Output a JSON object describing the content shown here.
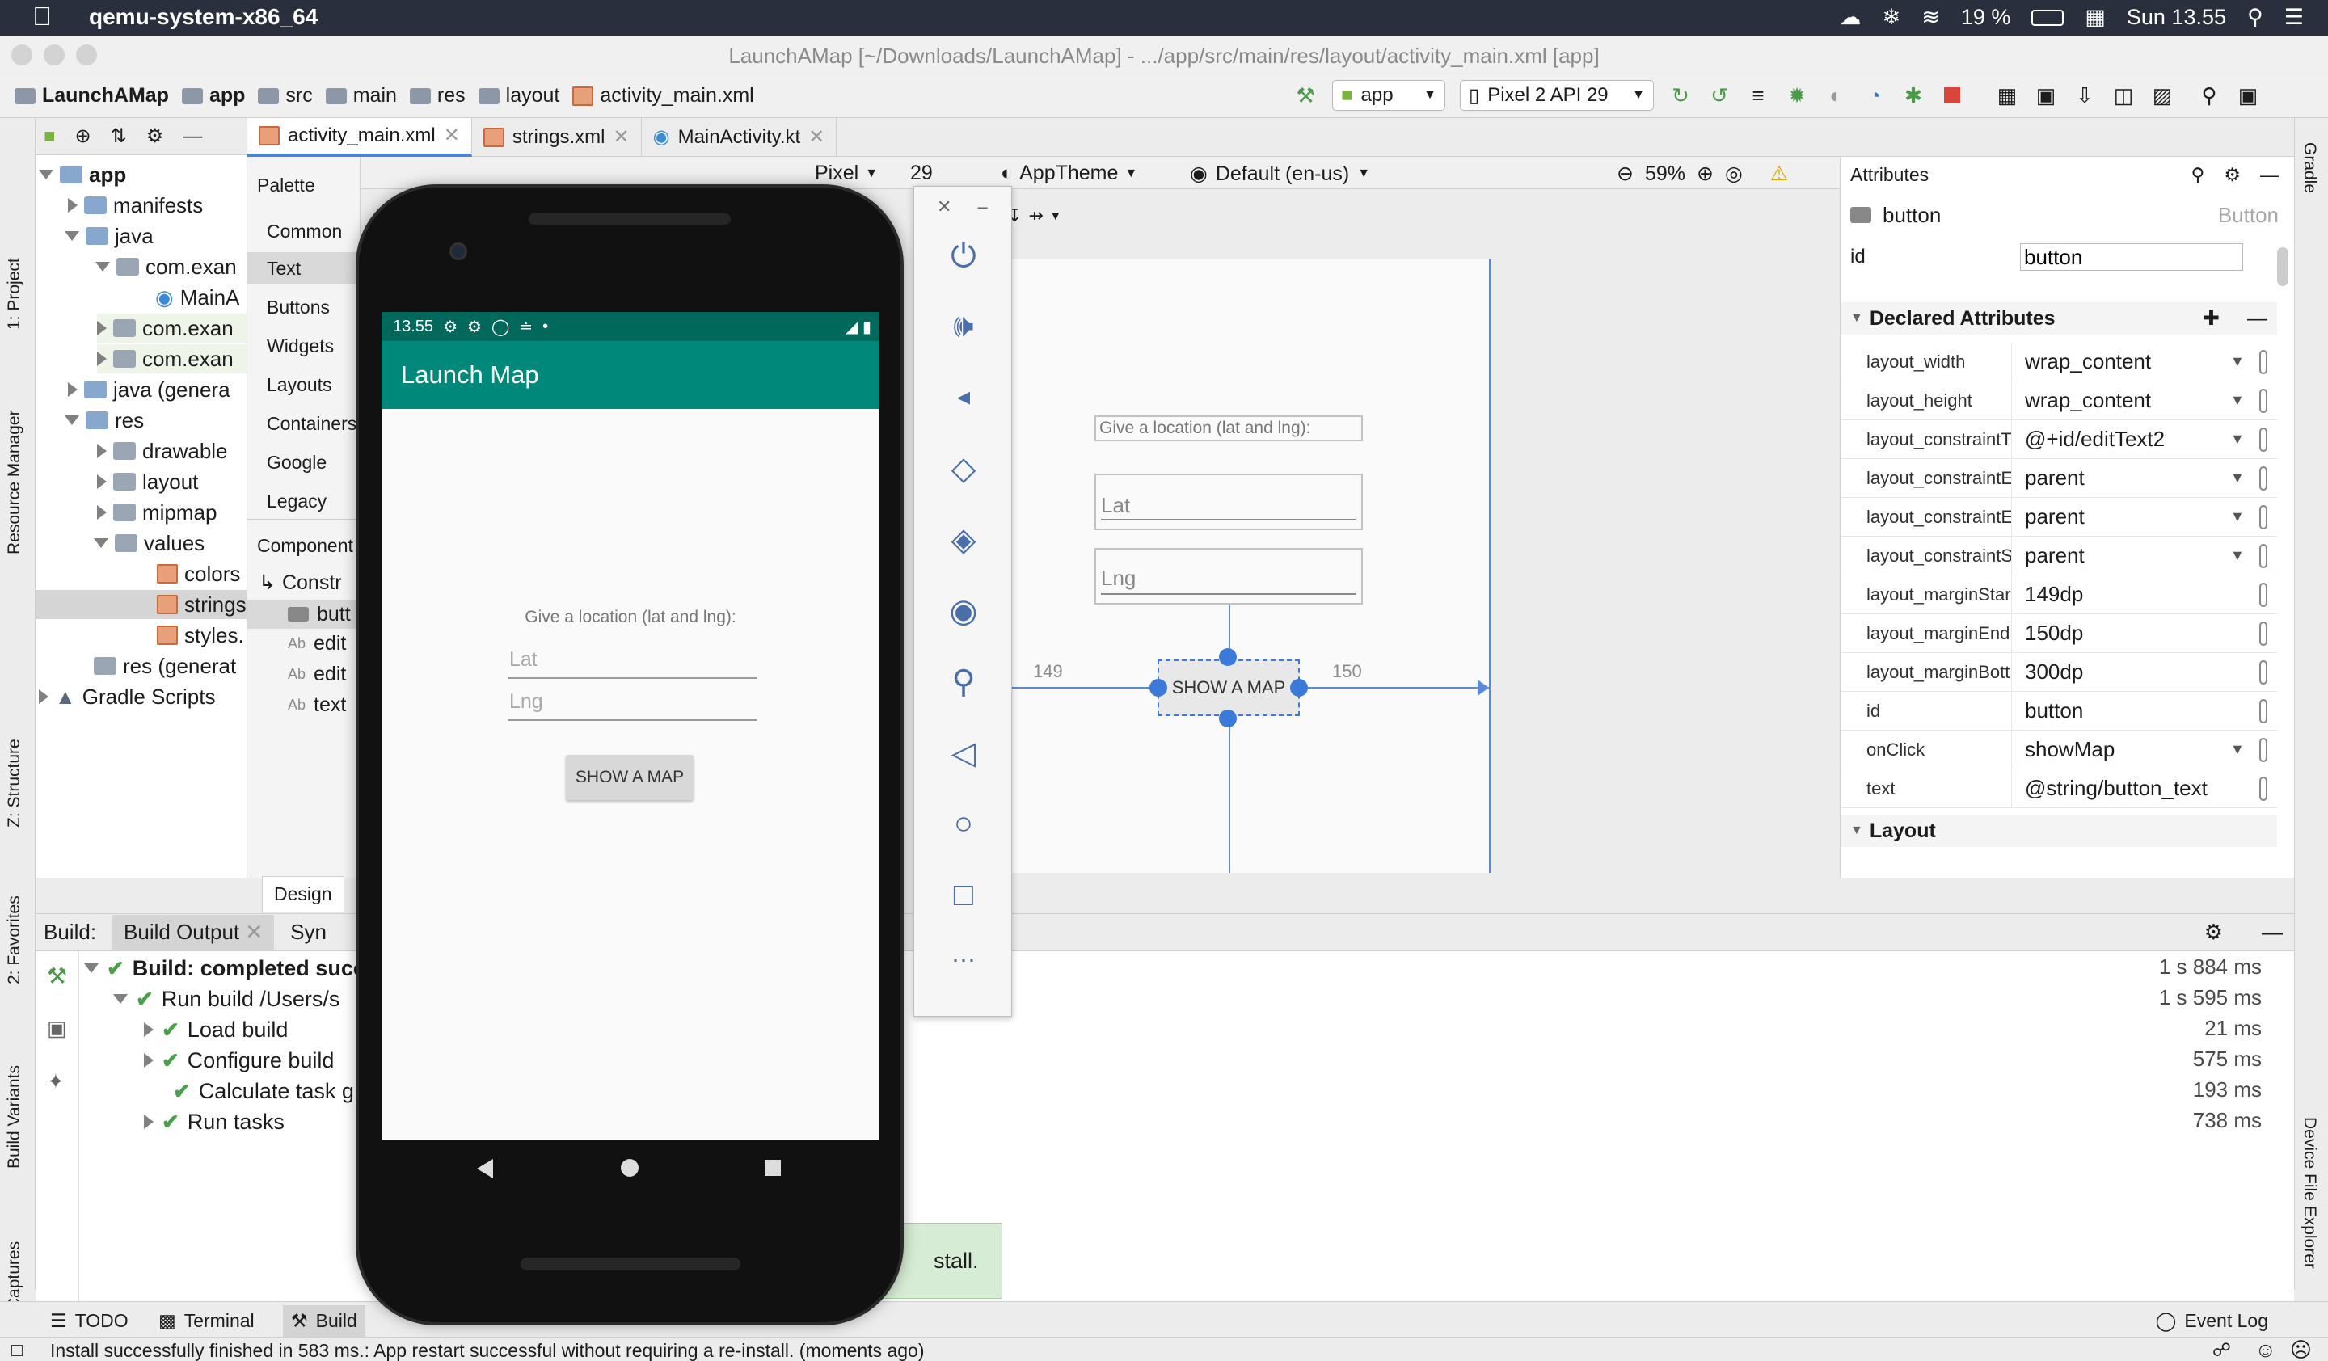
{
  "mac": {
    "app_name": "qemu-system-x86_64",
    "battery": "19 %",
    "clock": "Sun 13.55"
  },
  "window": {
    "title": "LaunchAMap [~/Downloads/LaunchAMap] - .../app/src/main/res/layout/activity_main.xml [app]"
  },
  "breadcrumbs": [
    "LaunchAMap",
    "app",
    "src",
    "main",
    "res",
    "layout",
    "activity_main.xml"
  ],
  "toolbar": {
    "run_config": "app",
    "device": "Pixel 2 API 29"
  },
  "editor_tabs": [
    "activity_main.xml",
    "strings.xml",
    "MainActivity.kt"
  ],
  "left_strip": {
    "project": "1: Project",
    "resource_manager": "Resource Manager",
    "structure": "Z: Structure",
    "favorites": "2: Favorites",
    "build_variants": "Build Variants",
    "layout_captures": "Layout Captures"
  },
  "right_strip": {
    "gradle": "Gradle",
    "device_file_explorer": "Device File Explorer"
  },
  "project_tree": [
    {
      "label": "app",
      "bold": true
    },
    {
      "label": "manifests"
    },
    {
      "label": "java"
    },
    {
      "label": "com.exan"
    },
    {
      "label": "MainA"
    },
    {
      "label": "com.exan"
    },
    {
      "label": "com.exan"
    },
    {
      "label": "java (genera"
    },
    {
      "label": "res"
    },
    {
      "label": "drawable"
    },
    {
      "label": "layout"
    },
    {
      "label": "mipmap"
    },
    {
      "label": "values"
    },
    {
      "label": "colors"
    },
    {
      "label": "strings"
    },
    {
      "label": "styles."
    },
    {
      "label": "res (generat"
    },
    {
      "label": "Gradle Scripts"
    }
  ],
  "palette": {
    "title": "Palette",
    "categories": [
      "Common",
      "Text",
      "Buttons",
      "Widgets",
      "Layouts",
      "Containers",
      "Google",
      "Legacy"
    ],
    "component_tree_title": "Component",
    "components": [
      "Constr",
      "butt",
      "edit",
      "edit",
      "text"
    ],
    "design_tab": "Design"
  },
  "design_toolbar": {
    "device": "Pixel",
    "api": "29",
    "theme": "AppTheme",
    "locale": "Default (en-us)",
    "zoom": "59%"
  },
  "blueprint": {
    "prompt": "Give a location (lat and lng):",
    "lat": "Lat",
    "lng": "Lng",
    "button": "SHOW A MAP",
    "margin_start": "149",
    "margin_end": "150"
  },
  "attributes": {
    "title": "Attributes",
    "component_id": "button",
    "component_type": "Button",
    "id_label": "id",
    "id_value": "button",
    "declared_title": "Declared Attributes",
    "rows": [
      {
        "k": "layout_width",
        "v": "wrap_content",
        "dd": true
      },
      {
        "k": "layout_height",
        "v": "wrap_content",
        "dd": true
      },
      {
        "k": "layout_constraintT",
        "v": "@+id/editText2",
        "dd": true
      },
      {
        "k": "layout_constraintE",
        "v": "parent",
        "dd": true
      },
      {
        "k": "layout_constraintE",
        "v": "parent",
        "dd": true
      },
      {
        "k": "layout_constraintS",
        "v": "parent",
        "dd": true
      },
      {
        "k": "layout_marginStar",
        "v": "149dp",
        "dd": false
      },
      {
        "k": "layout_marginEnd",
        "v": "150dp",
        "dd": false
      },
      {
        "k": "layout_marginBott",
        "v": "300dp",
        "dd": false
      },
      {
        "k": "id",
        "v": "button",
        "dd": false
      },
      {
        "k": "onClick",
        "v": "showMap",
        "dd": true
      },
      {
        "k": "text",
        "v": "@string/button_text",
        "dd": false
      }
    ],
    "layout_title": "Layout"
  },
  "build": {
    "label": "Build:",
    "tab_output": "Build Output",
    "tab_sync": "Syn",
    "lines": [
      {
        "label": "Build: completed succ",
        "time": "1 s 884 ms"
      },
      {
        "label": "Run build /Users/s",
        "time": "1 s 595 ms"
      },
      {
        "label": "Load build",
        "time": "21 ms"
      },
      {
        "label": "Configure build",
        "time": "575 ms"
      },
      {
        "label": "Calculate task g",
        "time": "193 ms"
      },
      {
        "label": "Run tasks",
        "time": "738 ms"
      }
    ],
    "toast": "stall."
  },
  "phone": {
    "status_time": "13.55",
    "app_title": "Launch Map",
    "prompt": "Give a location (lat and lng):",
    "lat_hint": "Lat",
    "lng_hint": "Lng",
    "button": "SHOW A MAP",
    "accent": "#00897b"
  },
  "tool_windows": {
    "todo": "TODO",
    "terminal": "Terminal",
    "build": "Build",
    "event_log": "Event Log"
  },
  "status_bar": {
    "message": "Install successfully finished in 583 ms.: App restart successful without requiring a re-install. (moments ago)"
  }
}
